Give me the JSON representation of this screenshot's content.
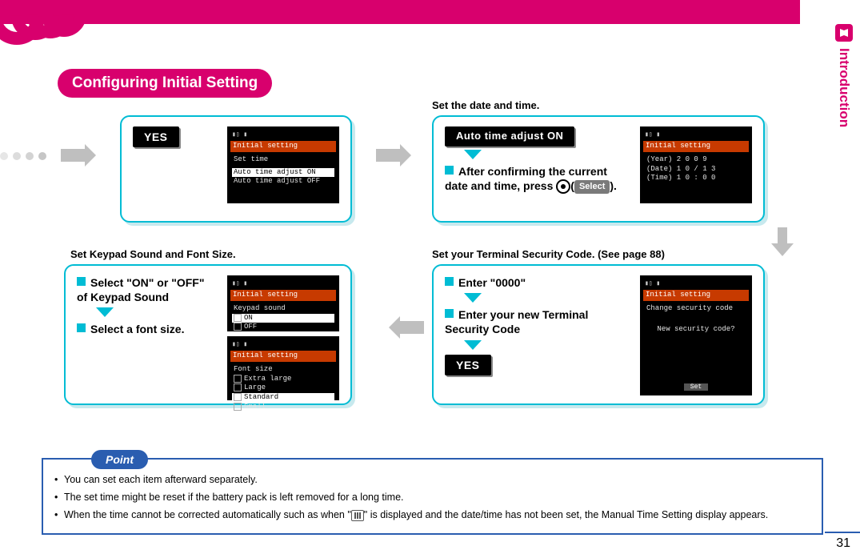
{
  "page_number": "31",
  "side_tab": {
    "label": "Introduction"
  },
  "heading": "Configuring Initial Setting",
  "captions": {
    "datetime": "Set the date and time.",
    "keypad": "Set Keypad Sound and Font Size.",
    "security": "Set your Terminal Security Code. (See page 88)"
  },
  "panels": {
    "yes": {
      "button": "YES"
    },
    "autotime": {
      "button": "Auto time adjust ON",
      "line1_pre": "After confirming the current date and time, press",
      "select_label": "Select",
      "line1_post": ")."
    },
    "security": {
      "line1": "Enter \"0000\"",
      "line2": "Enter your new Terminal Security Code",
      "button": "YES"
    },
    "keypad": {
      "line1": "Select \"ON\" or \"OFF\" of Keypad Sound",
      "line2": "Select a font size."
    }
  },
  "screens": {
    "set_time": {
      "title": "Initial setting",
      "subtitle": "Set time",
      "opts": [
        "Auto time adjust ON",
        "Auto time adjust OFF"
      ]
    },
    "date_disp": {
      "title": "Initial setting",
      "lines": [
        "(Year) 2 0 0 9",
        "(Date) 1 0 / 1 3",
        "(Time) 1 0 : 0 0"
      ]
    },
    "sec_code": {
      "title": "Initial setting",
      "subtitle": "Change security code",
      "prompt": "New security code?",
      "softkey": "Set"
    },
    "keypad_sound": {
      "title": "Initial setting",
      "subtitle": "Keypad sound",
      "opts": [
        "ON",
        "OFF"
      ]
    },
    "font_size": {
      "title": "Initial setting",
      "subtitle": "Font size",
      "opts": [
        "Extra large",
        "Large",
        "Standard",
        "Small"
      ]
    }
  },
  "point": {
    "tag": "Point",
    "items": [
      "You can set each item afterward separately.",
      "The set time might be reset if the battery pack is left removed for a long time.",
      {
        "pre": "When the time cannot be corrected automatically such as when \"",
        "post": "\" is displayed and the date/time has not been set, the Manual Time Setting display appears."
      }
    ]
  }
}
